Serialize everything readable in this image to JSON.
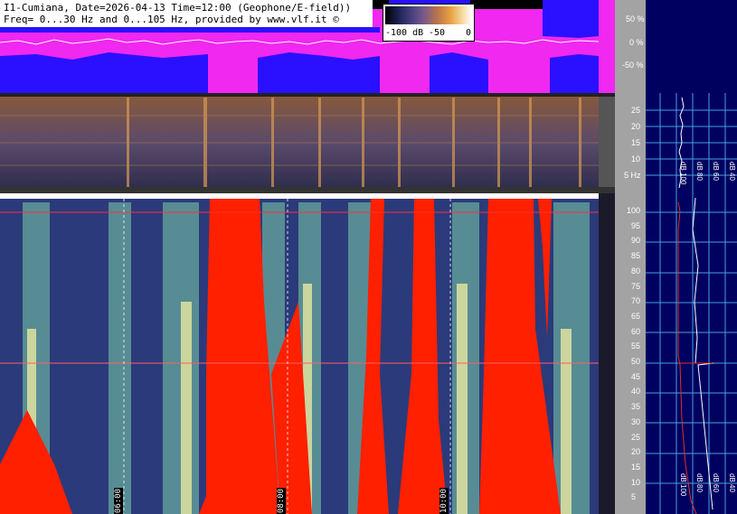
{
  "header": {
    "line1": "I1-Cumiana, Date=2026-04-13 Time=12:00 (Geophone/E-field))",
    "line2": "Freq= 0...30 Hz and 0...105 Hz, provided by www.vlf.it ©"
  },
  "color_scale": {
    "labels": [
      "-100 dB",
      "-50",
      "0"
    ]
  },
  "top_scale": {
    "labels": [
      "50 %",
      "0 %",
      "-50 %"
    ]
  },
  "mid_scale": {
    "labels": [
      "25",
      "20",
      "15",
      "10",
      "5 Hz"
    ]
  },
  "main_scale": {
    "labels": [
      "100",
      "95",
      "90",
      "85",
      "80",
      "75",
      "70",
      "65",
      "60",
      "55",
      "50",
      "45",
      "40",
      "35",
      "30",
      "25",
      "20",
      "15",
      "10",
      "5"
    ]
  },
  "side_mid_labels": [
    "dB 100",
    "dB 80",
    "dB 60",
    "dB 40",
    "dB 20"
  ],
  "side_bottom_labels": [
    "dB 100",
    "dB 80",
    "dB 60",
    "dB 40",
    "dB 20"
  ],
  "time_labels": [
    "06:00",
    "08:00",
    "10:00"
  ],
  "colors": {
    "blue": "#2a10ff",
    "magenta": "#f028f0",
    "red_signal": "#ff2000",
    "spectro_bg": "#2b3a7a"
  }
}
